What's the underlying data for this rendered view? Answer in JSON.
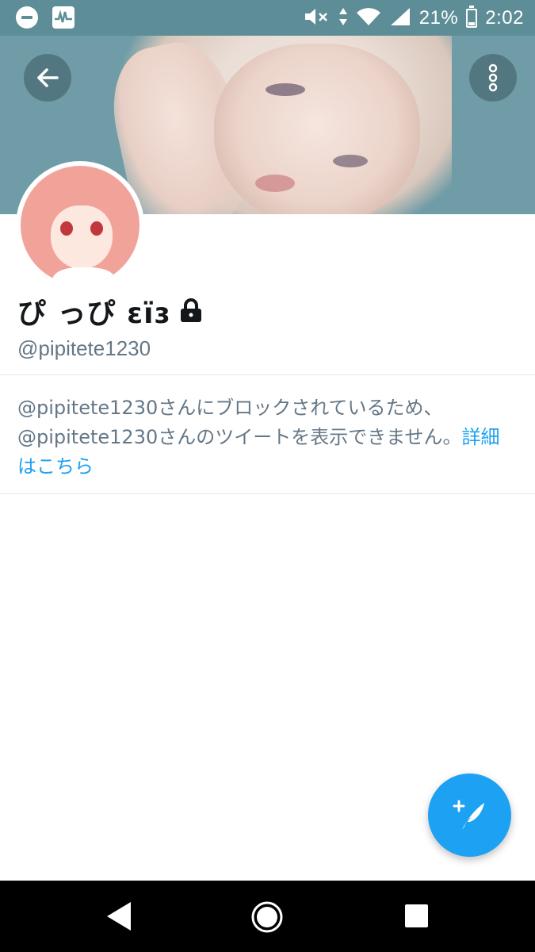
{
  "status_bar": {
    "battery": "21%",
    "time": "2:02",
    "icons": [
      "do-not-disturb-icon",
      "pulse-app-icon",
      "mute-icon",
      "data-arrows-icon",
      "wifi-icon",
      "signal-icon",
      "battery-charging-icon"
    ]
  },
  "header": {
    "back_icon": "arrow-left-icon",
    "more_icon": "more-vertical-icon"
  },
  "profile": {
    "display_name": "ぴ っぴ ɛïɜ",
    "protected_icon": "lock-icon",
    "handle": "@pipitete1230"
  },
  "blocked_notice": {
    "message": "@pipitete1230さんにブロックされているため、@pipitete1230さんのツイートを表示できません。",
    "link_label": "詳細はこちら"
  },
  "compose": {
    "icon": "compose-tweet-icon"
  },
  "nav_bar": {
    "icons": [
      "nav-back-icon",
      "nav-home-icon",
      "nav-recents-icon"
    ]
  },
  "colors": {
    "status_bar": "#5d8d96",
    "accent": "#1da1f2",
    "secondary_text": "#657786",
    "primary_text": "#14171a"
  }
}
